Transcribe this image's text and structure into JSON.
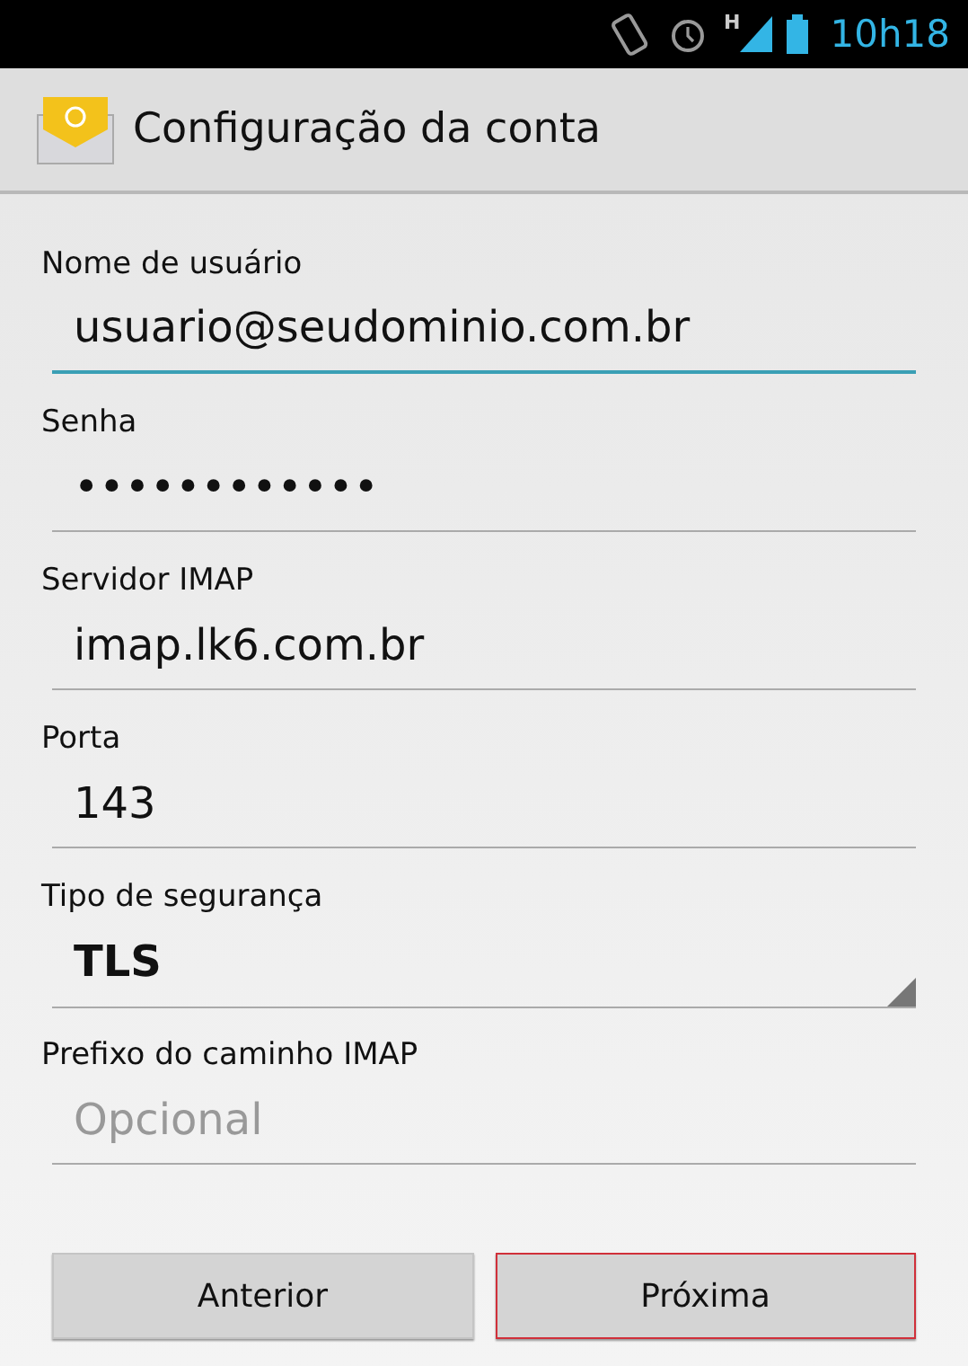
{
  "status_bar": {
    "time": "10h18",
    "network": "H"
  },
  "action_bar": {
    "title": "Configuração da conta"
  },
  "fields": [
    {
      "label": "Nome de usuário",
      "kind": "text",
      "value": "usuario@seudominio.com.br",
      "focused": true
    },
    {
      "label": "Senha",
      "kind": "text",
      "value": "••••••••••••",
      "focused": false
    },
    {
      "label": "Servidor IMAP",
      "kind": "text",
      "value": "imap.lk6.com.br",
      "focused": false
    },
    {
      "label": "Porta",
      "kind": "text",
      "value": "143",
      "focused": false
    },
    {
      "label": "Tipo de segurança",
      "kind": "select",
      "value": "TLS",
      "focused": false
    },
    {
      "label": "Prefixo do caminho IMAP",
      "kind": "text",
      "placeholder": "Opcional",
      "focused": false
    }
  ],
  "buttons": [
    {
      "label": "Anterior",
      "selected": false
    },
    {
      "label": "Próxima",
      "selected": true
    }
  ]
}
